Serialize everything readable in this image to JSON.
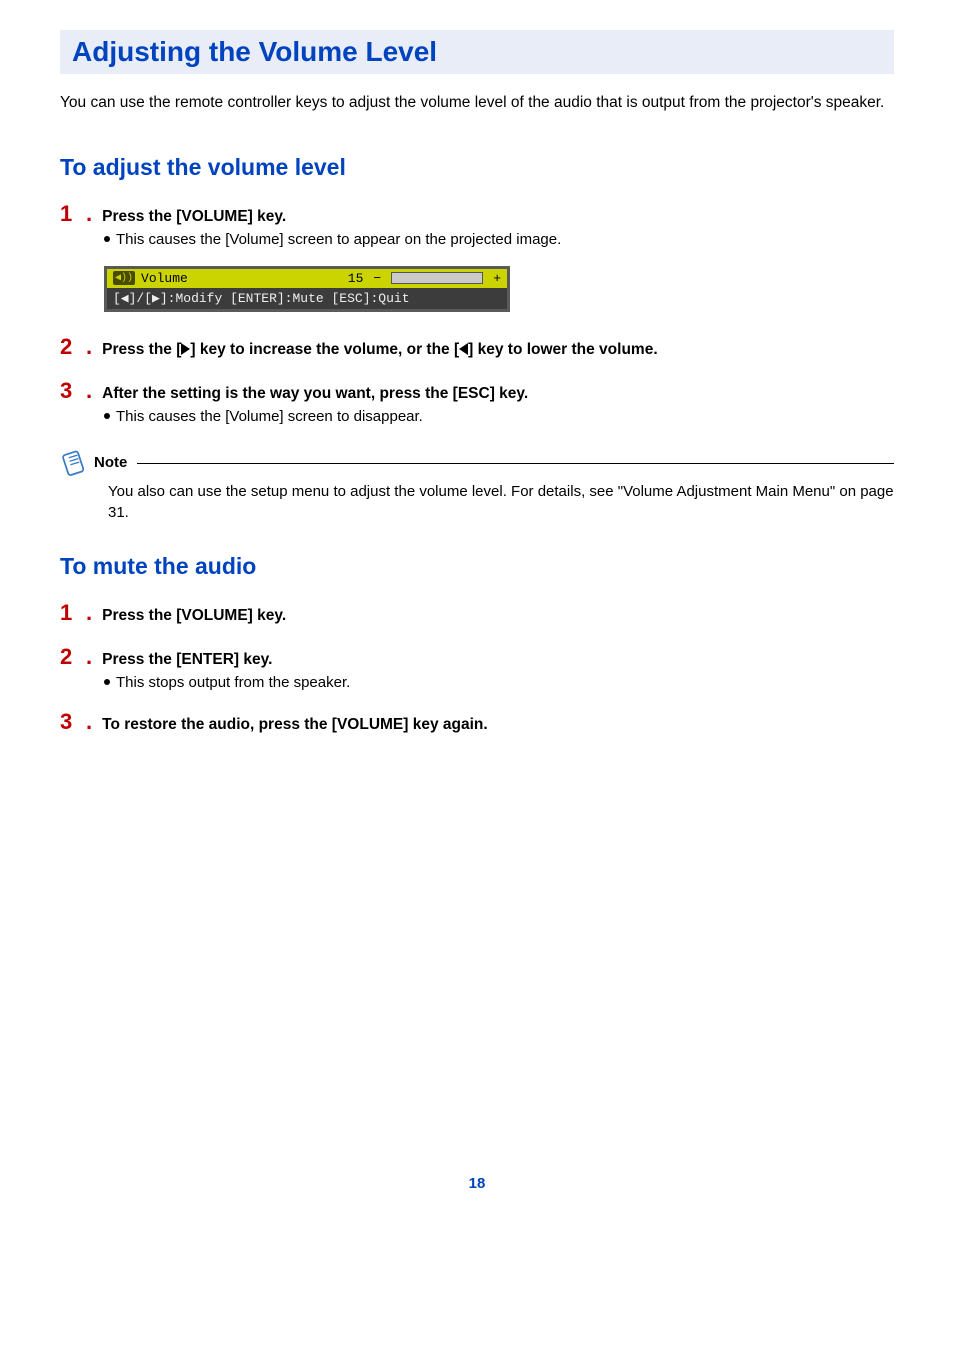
{
  "title": "Adjusting the Volume Level",
  "intro": "You can use the remote controller keys to adjust the volume level of the audio that is output from the projector's speaker.",
  "section1": {
    "heading": "To adjust the volume level",
    "steps": [
      {
        "num": "1",
        "title": "Press the [VOLUME] key.",
        "bullet": "This causes the [Volume] screen to appear on the projected image."
      },
      {
        "num": "2",
        "title_pre": "Press the [",
        "title_mid": "] key to increase the volume, or the [",
        "title_post": "] key to lower the volume."
      },
      {
        "num": "3",
        "title": "After the setting is the way you want, press the [ESC] key.",
        "bullet": "This causes the [Volume] screen to disappear."
      }
    ],
    "osd": {
      "label": "Volume",
      "value": "15",
      "minus": "−",
      "plus": "+",
      "help": "[◀]/[▶]:Modify [ENTER]:Mute [ESC]:Quit"
    }
  },
  "note": {
    "label": "Note",
    "text": "You also can use the setup menu to adjust the volume level. For details, see \"Volume Adjustment Main Menu\" on page 31."
  },
  "section2": {
    "heading": "To mute the audio",
    "steps": [
      {
        "num": "1",
        "title": "Press the [VOLUME] key."
      },
      {
        "num": "2",
        "title": "Press the [ENTER] key.",
        "bullet": "This stops output from the speaker."
      },
      {
        "num": "3",
        "title": "To restore the audio, press the [VOLUME] key again."
      }
    ]
  },
  "page_number": "18"
}
